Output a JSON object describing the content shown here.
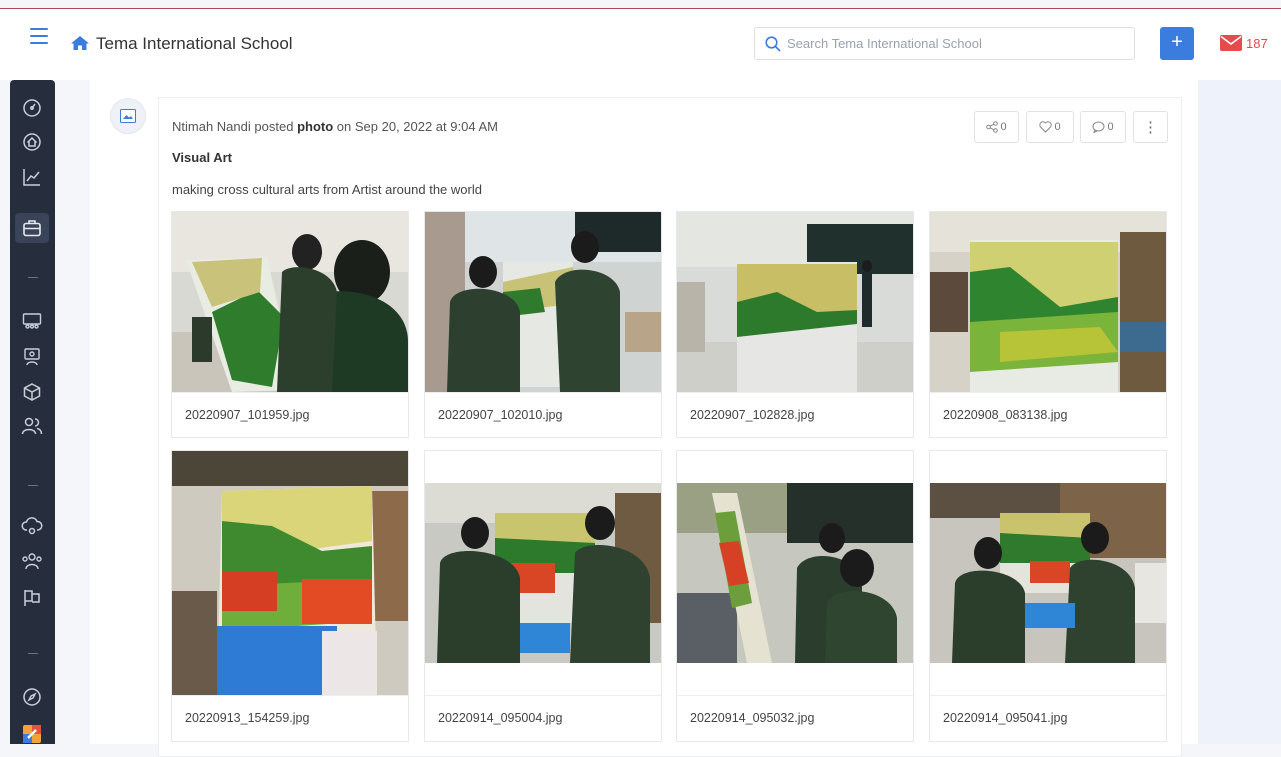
{
  "header": {
    "title": "Tema International School",
    "search_placeholder": "Search Tema International School",
    "add_label": "+",
    "mail_count": "187",
    "colors": {
      "accent": "#3b7ddd",
      "mail": "#e54b4b",
      "sidebar": "#262e3e"
    }
  },
  "sidebar": {
    "items": [
      {
        "icon": "dashboard-icon"
      },
      {
        "icon": "home-circle-icon"
      },
      {
        "icon": "analytics-icon"
      },
      {
        "icon": "briefcase-icon",
        "active": true
      },
      {
        "icon": "classroom-icon"
      },
      {
        "icon": "teacher-board-icon"
      },
      {
        "icon": "cube-icon"
      },
      {
        "icon": "users-icon"
      },
      {
        "icon": "cloud-icon"
      },
      {
        "icon": "community-icon"
      },
      {
        "icon": "flag-icon"
      },
      {
        "icon": "compass-icon"
      },
      {
        "icon": "app-icon"
      }
    ]
  },
  "post": {
    "author": "Ntimah Nandi",
    "verb": "posted",
    "type": "photo",
    "date_text": "on Sep 20, 2022 at 9:04 AM",
    "title": "Visual Art",
    "description": "making cross cultural arts from Artist around the world",
    "share_count": "0",
    "like_count": "0",
    "comment_count": "0",
    "more_label": "⋮"
  },
  "photos": [
    {
      "filename": "20220907_101959.jpg",
      "scene": "landscape"
    },
    {
      "filename": "20220907_102010.jpg",
      "scene": "landscape"
    },
    {
      "filename": "20220907_102828.jpg",
      "scene": "landscape"
    },
    {
      "filename": "20220908_083138.jpg",
      "scene": "landscape"
    },
    {
      "filename": "20220913_154259.jpg",
      "scene": "portrait"
    },
    {
      "filename": "20220914_095004.jpg",
      "scene": "landscape"
    },
    {
      "filename": "20220914_095032.jpg",
      "scene": "landscape"
    },
    {
      "filename": "20220914_095041.jpg",
      "scene": "landscape"
    }
  ]
}
